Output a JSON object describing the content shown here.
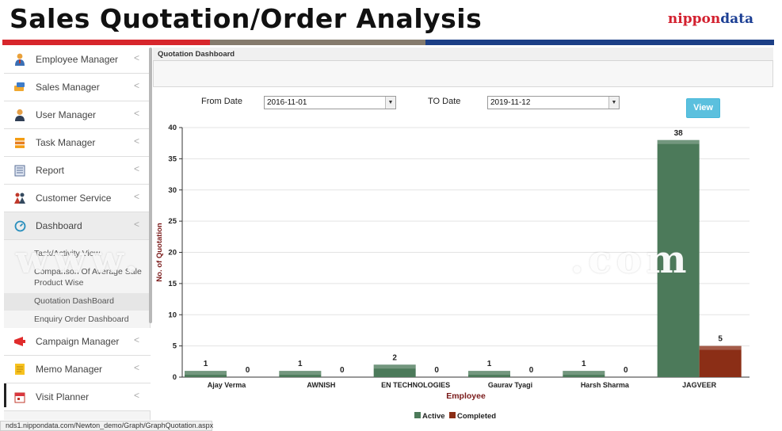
{
  "header": {
    "title": "Sales Quotation/Order Analysis",
    "brand_part1": "nippon",
    "brand_part2": "data"
  },
  "sidebar": {
    "items": [
      {
        "label": "Employee Manager",
        "icon": "employee-icon"
      },
      {
        "label": "Sales Manager",
        "icon": "sales-icon"
      },
      {
        "label": "User Manager",
        "icon": "user-icon"
      },
      {
        "label": "Task Manager",
        "icon": "task-icon"
      },
      {
        "label": "Report",
        "icon": "report-icon"
      },
      {
        "label": "Customer Service",
        "icon": "customer-service-icon"
      },
      {
        "label": "Dashboard",
        "icon": "dashboard-icon"
      },
      {
        "label": "Campaign Manager",
        "icon": "megaphone-icon"
      },
      {
        "label": "Memo Manager",
        "icon": "memo-icon"
      },
      {
        "label": "Visit Planner",
        "icon": "calendar-icon"
      }
    ],
    "dashboard_subitems": [
      "Task/Activity View",
      "Comparison Of Average Sale",
      "Product Wise",
      "Quotation DashBoard",
      "Enquiry Order Dashboard"
    ],
    "chevron": "<"
  },
  "panel": {
    "title": "Quotation Dashboard"
  },
  "filters": {
    "from_label": "From Date",
    "from_value": "2016-11-01",
    "to_label": "TO Date",
    "to_value": "2019-11-12",
    "view_label": "View",
    "drop_glyph": "▼"
  },
  "chart_data": {
    "type": "bar",
    "title": "",
    "xlabel": "Employee",
    "ylabel": "No. of Quotation",
    "ylim": [
      0,
      40
    ],
    "yticks": [
      0,
      5,
      10,
      15,
      20,
      25,
      30,
      35,
      40
    ],
    "categories": [
      "Ajay Verma",
      "AWNISH",
      "EN TECHNOLOGIES",
      "Gaurav Tyagi",
      "Harsh Sharma",
      "JAGVEER"
    ],
    "series": [
      {
        "name": "Active",
        "color": "#4c7a5a",
        "values": [
          1,
          1,
          2,
          1,
          1,
          38
        ]
      },
      {
        "name": "Completed",
        "color": "#8b2e16",
        "values": [
          0,
          0,
          0,
          0,
          0,
          5
        ]
      }
    ],
    "grid": true,
    "legend": "bottom-center"
  },
  "watermark": {
    "text_left": "www.",
    "text_right": ".com"
  },
  "status": {
    "url": "nds1.nippondata.com/Newton_demo/Graph/GraphQuotation.aspx"
  }
}
